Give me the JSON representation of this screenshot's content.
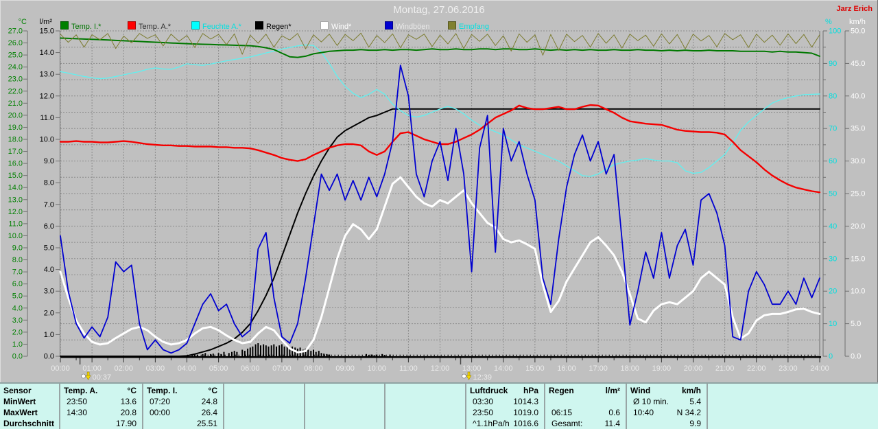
{
  "header": {
    "title": "Montag, 27.06.2016",
    "watermark": "Jarz Erich"
  },
  "axes_units": {
    "temp": "°C",
    "rain": "l/m²",
    "humidity": "%",
    "wind": "km/h"
  },
  "legend": [
    {
      "label": "Temp. I.*",
      "swatch": "#008000",
      "text_color": "#007500"
    },
    {
      "label": "Temp. A.*",
      "swatch": "#ff0000",
      "text_color": "#2a2a2a"
    },
    {
      "label": "Feuchte A.*",
      "swatch": "#00ffff",
      "text_color": "#00e0e0"
    },
    {
      "label": "Regen*",
      "swatch": "#000000",
      "text_color": "#000000"
    },
    {
      "label": "Wind*",
      "swatch": "#ffffff",
      "text_color": "#ffffff"
    },
    {
      "label": "Windböen",
      "swatch": "#0000d0",
      "text_color": "#e8e8e8"
    },
    {
      "label": "Empfang",
      "swatch": "#80802f",
      "text_color": "#00e0e0"
    }
  ],
  "markers": [
    {
      "label": "00:37",
      "t": 0.62
    },
    {
      "label": "12:39",
      "t": 12.65
    }
  ],
  "chart_data": {
    "type": "line",
    "title": "Montag, 27.06.2016",
    "x_unit": "hours",
    "x_range": [
      0,
      24
    ],
    "x_step": 0.25,
    "x_tick_format": "HH:00",
    "grid": true,
    "axes": {
      "temp_c": {
        "unit": "°C",
        "min": 0,
        "max": 27,
        "step": 1,
        "color": "#008000"
      },
      "lm2": {
        "unit": "l/m²",
        "min": 0,
        "max": 15,
        "step": 1,
        "color": "#000000"
      },
      "percent": {
        "unit": "%",
        "min": 0,
        "max": 100,
        "step": 10,
        "color": "#00dede"
      },
      "kmh": {
        "unit": "km/h",
        "min": 0,
        "max": 50,
        "step": 5,
        "color": "#ffffff"
      }
    },
    "series": [
      {
        "name": "Regen* Summe",
        "axis": "lm2",
        "color": "#000000",
        "width": 2,
        "values": [
          0,
          0,
          0,
          0,
          0,
          0,
          0,
          0,
          0,
          0,
          0,
          0,
          0,
          0,
          0,
          0,
          0.02,
          0.1,
          0.2,
          0.3,
          0.45,
          0.6,
          0.8,
          1.1,
          1.5,
          2.1,
          2.8,
          3.6,
          4.6,
          5.6,
          6.6,
          7.5,
          8.3,
          9.0,
          9.6,
          10.1,
          10.4,
          10.6,
          10.8,
          11.0,
          11.1,
          11.25,
          11.4,
          11.4,
          11.4,
          11.4,
          11.4,
          11.4,
          11.4,
          11.4,
          11.4,
          11.4,
          11.4,
          11.4,
          11.4,
          11.4,
          11.4,
          11.4,
          11.4,
          11.4,
          11.4,
          11.4,
          11.4,
          11.4,
          11.4,
          11.4,
          11.4,
          11.4,
          11.4,
          11.4,
          11.4,
          11.4,
          11.4,
          11.4,
          11.4,
          11.4,
          11.4,
          11.4,
          11.4,
          11.4,
          11.4,
          11.4,
          11.4,
          11.4,
          11.4,
          11.4,
          11.4,
          11.4,
          11.4,
          11.4,
          11.4,
          11.4,
          11.4,
          11.4,
          11.4,
          11.4,
          11.4
        ]
      },
      {
        "name": "Feuchte A.*",
        "axis": "percent",
        "color": "#63efef",
        "width": 1.4,
        "values": [
          87.5,
          87.0,
          86.5,
          86.0,
          85.6,
          85.3,
          85.5,
          86.0,
          86.5,
          87.0,
          87.5,
          88.2,
          88.6,
          88.3,
          88.2,
          88.9,
          89.9,
          89.6,
          89.4,
          89.8,
          90.3,
          90.8,
          91.2,
          91.6,
          92.0,
          92.6,
          93.2,
          93.8,
          94.4,
          94.9,
          95.4,
          95.7,
          95.5,
          93.5,
          90.0,
          86.0,
          83.0,
          80.8,
          79.5,
          80.5,
          82.0,
          80.5,
          77.5,
          75.5,
          74.0,
          73.5,
          74.0,
          75.0,
          76.0,
          76.8,
          76.0,
          74.5,
          72.6,
          71.0,
          70.0,
          69.0,
          68.0,
          66.5,
          65.0,
          64.0,
          63.0,
          62.0,
          61.0,
          60.0,
          58.5,
          57.0,
          55.5,
          55.3,
          56.0,
          57.5,
          58.9,
          59.5,
          60.0,
          60.3,
          60.8,
          60.3,
          60.0,
          60.0,
          59.5,
          57.0,
          56.2,
          56.5,
          58.0,
          60.0,
          62.0,
          65.5,
          69.4,
          72.0,
          74.0,
          76.0,
          77.8,
          78.8,
          79.5,
          80.0,
          80.4,
          80.5,
          80.6
        ]
      },
      {
        "name": "Temp. I.*",
        "axis": "temp_c",
        "color": "#007800",
        "width": 2,
        "values": [
          26.4,
          26.38,
          26.35,
          26.32,
          26.3,
          26.27,
          26.24,
          26.21,
          26.18,
          26.15,
          26.12,
          26.09,
          26.06,
          26.03,
          26.0,
          25.97,
          25.94,
          25.91,
          25.89,
          25.87,
          25.85,
          25.83,
          25.81,
          25.79,
          25.77,
          25.7,
          25.6,
          25.45,
          25.15,
          24.85,
          24.8,
          24.9,
          25.1,
          25.2,
          25.3,
          25.35,
          25.4,
          25.4,
          25.45,
          25.4,
          25.4,
          25.45,
          25.4,
          25.45,
          25.45,
          25.4,
          25.45,
          25.5,
          25.45,
          25.45,
          25.5,
          25.45,
          25.45,
          25.5,
          25.5,
          25.45,
          25.5,
          25.5,
          25.45,
          25.45,
          25.5,
          25.45,
          25.4,
          25.45,
          25.4,
          25.45,
          25.4,
          25.45,
          25.4,
          25.4,
          25.45,
          25.4,
          25.4,
          25.45,
          25.4,
          25.4,
          25.35,
          25.4,
          25.35,
          25.4,
          25.35,
          25.35,
          25.4,
          25.35,
          25.35,
          25.35,
          25.3,
          25.3,
          25.3,
          25.3,
          25.25,
          25.3,
          25.25,
          25.25,
          25.2,
          25.15,
          24.9
        ]
      },
      {
        "name": "Temp. A.*",
        "axis": "temp_c",
        "color": "#f40000",
        "width": 2.4,
        "values": [
          17.8,
          17.8,
          17.85,
          17.8,
          17.8,
          17.75,
          17.75,
          17.8,
          17.85,
          17.8,
          17.7,
          17.6,
          17.55,
          17.5,
          17.5,
          17.45,
          17.45,
          17.4,
          17.4,
          17.4,
          17.35,
          17.35,
          17.3,
          17.3,
          17.25,
          17.1,
          16.9,
          16.7,
          16.45,
          16.3,
          16.2,
          16.35,
          16.7,
          17.0,
          17.3,
          17.5,
          17.6,
          17.6,
          17.5,
          17.0,
          16.7,
          17.0,
          17.8,
          18.5,
          18.6,
          18.3,
          18.0,
          17.8,
          17.6,
          17.6,
          17.8,
          18.1,
          18.4,
          18.8,
          19.3,
          19.8,
          20.1,
          20.4,
          20.8,
          20.6,
          20.5,
          20.5,
          20.6,
          20.7,
          20.5,
          20.5,
          20.7,
          20.85,
          20.8,
          20.5,
          20.2,
          19.8,
          19.5,
          19.4,
          19.3,
          19.25,
          19.2,
          19.0,
          18.8,
          18.7,
          18.65,
          18.6,
          18.6,
          18.55,
          18.4,
          17.8,
          17.1,
          16.6,
          16.1,
          15.5,
          15.0,
          14.6,
          14.25,
          14.0,
          13.85,
          13.7,
          13.6
        ]
      },
      {
        "name": "Wind*",
        "axis": "kmh",
        "color": "#ffffff",
        "width": 3,
        "values": [
          13.0,
          9.0,
          5.5,
          3.5,
          2.2,
          1.8,
          2.0,
          2.8,
          3.5,
          4.2,
          4.5,
          4.0,
          3.0,
          2.2,
          1.8,
          2.0,
          2.5,
          3.5,
          4.3,
          4.5,
          4.0,
          3.2,
          2.5,
          2.0,
          2.2,
          3.5,
          4.5,
          4.0,
          2.5,
          1.2,
          0.6,
          0.8,
          2.5,
          6.0,
          10.5,
          15.0,
          18.5,
          20.3,
          19.5,
          18.0,
          19.5,
          23.0,
          26.5,
          27.5,
          26.0,
          24.5,
          23.5,
          23.0,
          24.0,
          23.5,
          24.5,
          25.5,
          23.5,
          22.0,
          20.5,
          19.8,
          18.0,
          17.5,
          17.8,
          17.2,
          16.5,
          11.0,
          6.8,
          8.5,
          11.5,
          13.5,
          15.5,
          17.5,
          18.3,
          17.0,
          15.5,
          13.0,
          9.5,
          5.8,
          5.2,
          7.0,
          8.0,
          8.3,
          8.0,
          9.0,
          10.0,
          12.0,
          13.0,
          12.0,
          11.0,
          6.0,
          2.7,
          3.5,
          5.5,
          6.3,
          6.5,
          6.5,
          6.8,
          7.2,
          7.3,
          6.8,
          6.5
        ]
      },
      {
        "name": "Windböen",
        "axis": "kmh",
        "color": "#0000d0",
        "width": 1.8,
        "values": [
          18.5,
          10.0,
          5.0,
          2.8,
          4.5,
          3.0,
          6.0,
          14.5,
          13.0,
          14.0,
          5.0,
          1.0,
          2.5,
          1.0,
          0.5,
          1.0,
          2.0,
          5.0,
          8.0,
          9.6,
          7.0,
          8.0,
          5.0,
          3.0,
          4.0,
          16.5,
          19.0,
          9.0,
          3.0,
          2.0,
          5.0,
          12.0,
          20.0,
          28.0,
          25.5,
          28.0,
          24.0,
          27.0,
          24.0,
          27.5,
          24.5,
          28.0,
          33.0,
          44.7,
          40.0,
          28.0,
          24.5,
          30.0,
          33.0,
          27.0,
          35.0,
          28.0,
          13.0,
          32.0,
          37.0,
          16.0,
          35.0,
          30.0,
          33.0,
          28.0,
          24.0,
          12.0,
          8.0,
          18.0,
          26.0,
          31.0,
          34.0,
          30.0,
          33.0,
          28.0,
          31.0,
          18.0,
          4.8,
          10.0,
          16.0,
          12.0,
          19.0,
          12.0,
          17.0,
          19.5,
          14.0,
          24.0,
          25.0,
          22.0,
          17.0,
          3.0,
          2.5,
          10.0,
          13.0,
          11.0,
          8.0,
          8.0,
          10.0,
          8.0,
          12.0,
          9.0,
          12.0
        ]
      },
      {
        "name": "Empfang",
        "axis": "percent",
        "color": "#7c7c30",
        "width": 1,
        "values": [
          99.0,
          96.5,
          98.8,
          95.0,
          98.8,
          97.3,
          99.2,
          94.6,
          98.4,
          96.3,
          99.2,
          97.7,
          98.8,
          95.4,
          99.0,
          96.8,
          98.6,
          94.9,
          99.2,
          97.5,
          98.9,
          95.8,
          99.1,
          92.8,
          98.7,
          96.2,
          99.0,
          95.0,
          98.5,
          97.2,
          99.2,
          94.5,
          98.8,
          96.6,
          99.0,
          95.5,
          98.9,
          97.0,
          99.3,
          95.0,
          98.6,
          96.4,
          99.1,
          94.8,
          98.8,
          97.4,
          99.0,
          95.2,
          98.7,
          96.0,
          99.2,
          94.6,
          98.9,
          96.8,
          99.0,
          95.5,
          98.5,
          93.8,
          99.1,
          96.5,
          98.8,
          92.5,
          98.9,
          94.0,
          99.0,
          96.7,
          98.6,
          95.0,
          99.2,
          96.2,
          98.8,
          94.7,
          99.0,
          97.0,
          98.7,
          95.3,
          99.1,
          96.0,
          98.9,
          94.5,
          99.0,
          96.9,
          98.6,
          95.1,
          99.2,
          97.3,
          98.8,
          94.9,
          99.0,
          96.5,
          98.7,
          95.6,
          99.1,
          96.1,
          98.9,
          95.0,
          98.8
        ]
      }
    ],
    "rain_bars": {
      "axis": "lm2",
      "color": "#000000",
      "points": [
        [
          4.17,
          0.08
        ],
        [
          4.25,
          0.12
        ],
        [
          4.33,
          0.08
        ],
        [
          4.5,
          0.1
        ],
        [
          4.58,
          0.15
        ],
        [
          4.75,
          0.1
        ],
        [
          4.83,
          0.12
        ],
        [
          5.0,
          0.15
        ],
        [
          5.08,
          0.1
        ],
        [
          5.17,
          0.2
        ],
        [
          5.33,
          0.15
        ],
        [
          5.42,
          0.2
        ],
        [
          5.5,
          0.25
        ],
        [
          5.58,
          0.2
        ],
        [
          5.75,
          0.3
        ],
        [
          5.83,
          0.25
        ],
        [
          5.92,
          0.35
        ],
        [
          6.0,
          0.4
        ],
        [
          6.08,
          0.45
        ],
        [
          6.17,
          0.55
        ],
        [
          6.25,
          0.6
        ],
        [
          6.33,
          0.5
        ],
        [
          6.42,
          0.55
        ],
        [
          6.5,
          0.5
        ],
        [
          6.58,
          0.45
        ],
        [
          6.67,
          0.5
        ],
        [
          6.75,
          0.55
        ],
        [
          6.83,
          0.45
        ],
        [
          6.92,
          0.5
        ],
        [
          7.0,
          0.55
        ],
        [
          7.08,
          0.45
        ],
        [
          7.17,
          0.5
        ],
        [
          7.25,
          0.4
        ],
        [
          7.33,
          0.45
        ],
        [
          7.42,
          0.4
        ],
        [
          7.5,
          0.35
        ],
        [
          7.58,
          0.4
        ],
        [
          7.67,
          0.3
        ],
        [
          7.75,
          0.35
        ],
        [
          7.83,
          0.3
        ],
        [
          7.92,
          0.25
        ],
        [
          8.0,
          0.3
        ],
        [
          8.08,
          0.2
        ],
        [
          8.17,
          0.25
        ],
        [
          8.25,
          0.15
        ],
        [
          8.33,
          0.12
        ],
        [
          8.42,
          0.1
        ],
        [
          8.5,
          0.08
        ],
        [
          9.67,
          0.1
        ],
        [
          9.75,
          0.06
        ],
        [
          9.83,
          0.08
        ],
        [
          9.92,
          0.05
        ],
        [
          10.0,
          0.08
        ],
        [
          10.17,
          0.1
        ],
        [
          10.25,
          0.06
        ],
        [
          10.42,
          0.08
        ]
      ]
    }
  },
  "summary_table": {
    "row_labels": [
      "Sensor",
      "MinWert",
      "MaxWert",
      "Durchschnitt"
    ],
    "columns": [
      {
        "header": "Temp. A.",
        "unit": "°C",
        "rows": [
          [
            "23:50",
            "13.6"
          ],
          [
            "14:30",
            "20.8"
          ],
          [
            "",
            "17.90"
          ]
        ]
      },
      {
        "header": "Temp. I.",
        "unit": "°C",
        "rows": [
          [
            "07:20",
            "24.8"
          ],
          [
            "00:00",
            "26.4"
          ],
          [
            "",
            "25.51"
          ]
        ]
      },
      {
        "header": "",
        "unit": "",
        "rows": [
          [
            "",
            ""
          ],
          [
            "",
            ""
          ],
          [
            "",
            ""
          ]
        ]
      },
      {
        "header": "",
        "unit": "",
        "rows": [
          [
            "",
            ""
          ],
          [
            "",
            ""
          ],
          [
            "",
            ""
          ]
        ]
      },
      {
        "header": "",
        "unit": "",
        "rows": [
          [
            "",
            ""
          ],
          [
            "",
            ""
          ],
          [
            "",
            ""
          ]
        ]
      },
      {
        "header": "Luftdruck",
        "unit": "hPa",
        "rows": [
          [
            "03:30",
            "1014.3"
          ],
          [
            "23:50",
            "1019.0"
          ],
          [
            "^1.1hPa/h",
            "1016.6"
          ]
        ]
      },
      {
        "header": "Regen",
        "unit": "l/m²",
        "rows": [
          [
            "",
            ""
          ],
          [
            "06:15",
            "0.6"
          ],
          [
            "Gesamt:",
            "11.4"
          ]
        ]
      },
      {
        "header": "Wind",
        "unit": "km/h",
        "rows": [
          [
            "Ø 10 min.",
            "5.4"
          ],
          [
            "10:40",
            "N 34.2"
          ],
          [
            "",
            "9.9"
          ]
        ]
      },
      {
        "header": "",
        "unit": "",
        "rows": [
          [
            "",
            ""
          ],
          [
            "",
            ""
          ],
          [
            "",
            ""
          ]
        ]
      }
    ]
  }
}
